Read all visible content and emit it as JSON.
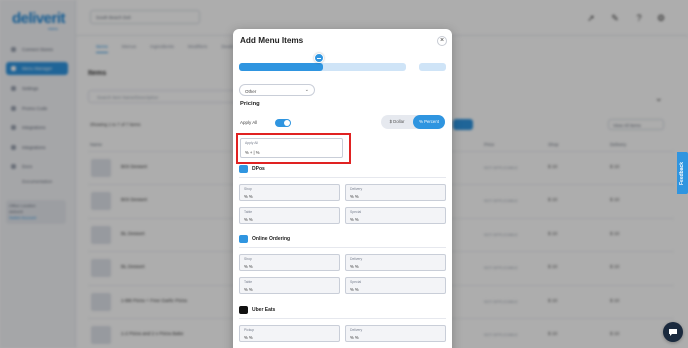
{
  "background": {
    "logo": "deliverit",
    "logo_sub": "menu",
    "sidebar": {
      "items": [
        {
          "label": "Connect Stores"
        },
        {
          "label": "Menu Manager"
        },
        {
          "label": "Settings"
        },
        {
          "label": "Promo Code"
        },
        {
          "label": "Integrations"
        },
        {
          "label": "Integrations"
        },
        {
          "label": "Docs"
        }
      ],
      "sub_item": "Documentation",
      "account_name": "Office Location",
      "account_email": "deliverit",
      "account_link": "Switch Account"
    },
    "location_select": "South Beach Deli",
    "tabs": [
      "Items",
      "Menus",
      "Ingredients",
      "Modifiers",
      "Deals"
    ],
    "page_title": "Items",
    "search_placeholder": "Search Item Name/Description",
    "showing": "Showing 1 to 7 of 7 items",
    "filter_all": "View All Items",
    "columns": [
      "Name",
      "Price",
      "Shop",
      "Delivery"
    ],
    "rows": [
      {
        "name": "BOI Dessert",
        "shop": "$ 10",
        "delivery": "$ 10",
        "muted": "NOT APPLICABLE"
      },
      {
        "name": "BOI Dessert",
        "shop": "$ 10",
        "delivery": "$ 10",
        "muted": "NOT APPLICABLE"
      },
      {
        "name": "BL Dessert",
        "shop": "$ 10",
        "delivery": "$ 10",
        "muted": "NOT APPLICABLE"
      },
      {
        "name": "BL Dessert",
        "shop": "$ 10",
        "delivery": "$ 10",
        "muted": "NOT APPLICABLE"
      },
      {
        "name": "1-BB Pizza + Free Garlic Pizza",
        "shop": "$ 10",
        "delivery": "$ 10",
        "muted": "NOT APPLICABLE"
      },
      {
        "name": "1-2 Pizza and 2 x Pizza Bake",
        "shop": "$ 10",
        "delivery": "$ 10",
        "muted": "NOT APPLICABLE"
      }
    ],
    "feedback": "Feedback"
  },
  "modal": {
    "title": "Add Menu Items",
    "close_glyph": "×",
    "progress_fraction": 0.5,
    "type_select": "Other",
    "section_title": "Pricing",
    "apply_all_label": "Apply All",
    "apply_all_on": true,
    "segment": {
      "dollar": "$ Dollar",
      "percent": "% Percent",
      "selected": "percent"
    },
    "apply_all_field": {
      "label": "Apply All",
      "value": "% + | %"
    },
    "channels": [
      {
        "name": "DPos",
        "icon": "dpos-icon",
        "color": "#2f95e0",
        "fields": [
          {
            "label": "Shop",
            "value": "% %"
          },
          {
            "label": "Delivery",
            "value": "% %"
          },
          {
            "label": "Table",
            "value": "% %"
          },
          {
            "label": "Special",
            "value": "% %"
          }
        ]
      },
      {
        "name": "Online Ordering",
        "icon": "online-ordering-icon",
        "color": "#2f95e0",
        "fields": [
          {
            "label": "Shop",
            "value": "% %"
          },
          {
            "label": "Delivery",
            "value": "% %"
          },
          {
            "label": "Table",
            "value": "% %"
          },
          {
            "label": "Special",
            "value": "% %"
          }
        ]
      },
      {
        "name": "Uber Eats",
        "icon": "uber-eats-icon",
        "color": "#111111",
        "fields": [
          {
            "label": "Pickup",
            "value": "% %"
          },
          {
            "label": "Delivery",
            "value": "% %"
          }
        ]
      }
    ]
  }
}
